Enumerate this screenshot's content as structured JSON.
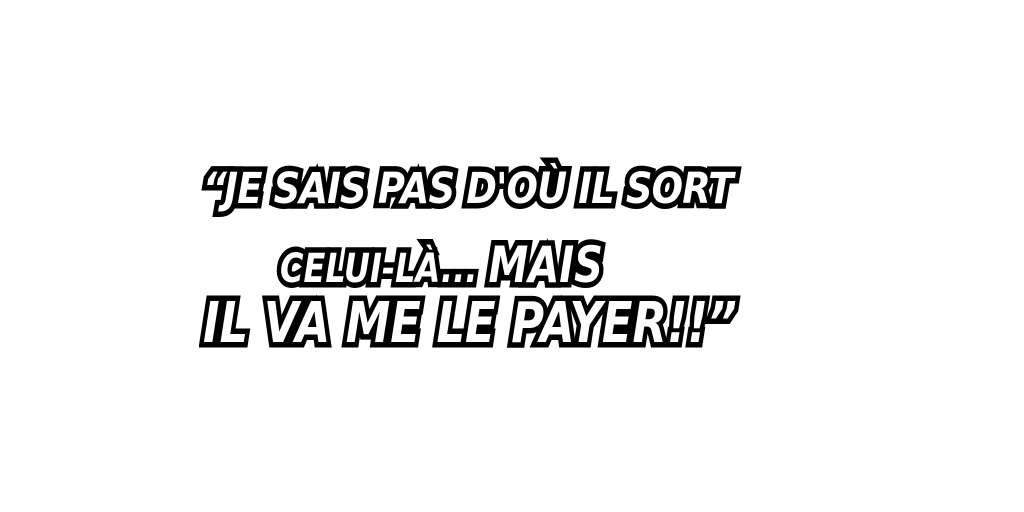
{
  "quote": {
    "line1": "“JE SAIS PAS D'OÙ IL SORT",
    "line2_small": "CELUI-LÀ... ",
    "line2_big": "MAIS",
    "line3": "IL VA ME LE PAYER!!”"
  },
  "colors": {
    "text_fill": "#ffffff",
    "text_outline": "#000000",
    "background": "#ffffff"
  }
}
